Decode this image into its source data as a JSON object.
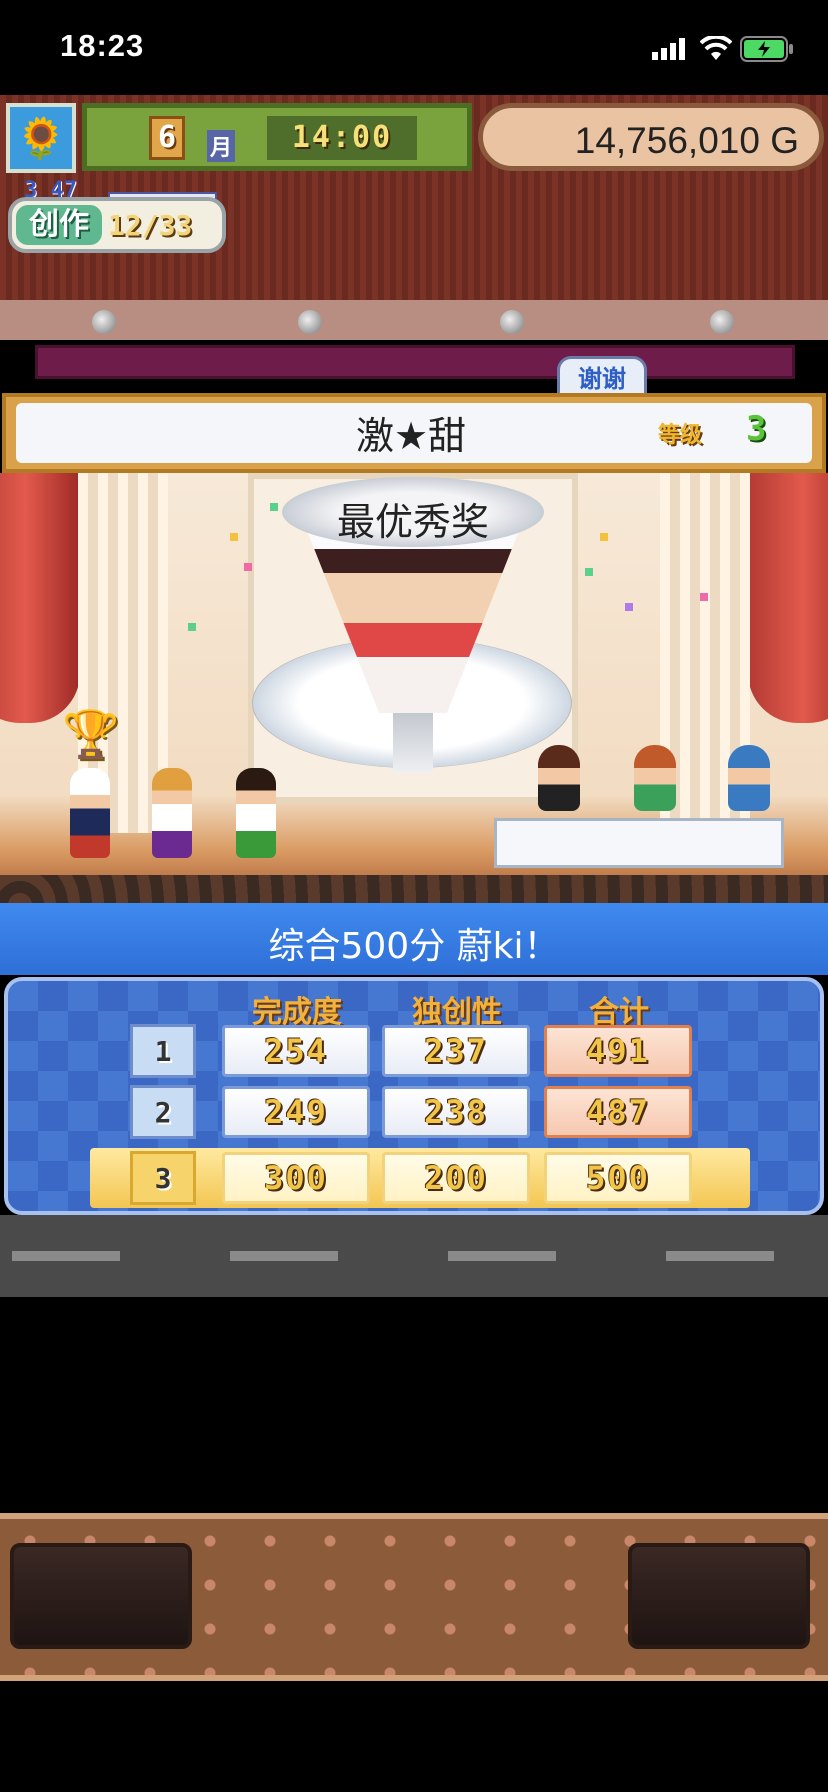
{
  "status_bar": {
    "time": "18:23"
  },
  "hud": {
    "month": "6",
    "month_label": "月",
    "clock": "14:00",
    "money": "14,756,010 G",
    "create_label": "创作",
    "create_count": "12/33",
    "create_sub": "3 47",
    "thanks_tab": "谢谢"
  },
  "dish": {
    "name": "激★甜",
    "grade_label": "等级",
    "grade_value": "3"
  },
  "stage": {
    "award": "最优秀奖"
  },
  "result": {
    "message": "综合500分 蔚ki！"
  },
  "scores": {
    "headers": [
      "完成度",
      "独创性",
      "合计"
    ],
    "rows": [
      {
        "rank": "1",
        "completion": "254",
        "originality": "237",
        "total": "491"
      },
      {
        "rank": "2",
        "completion": "249",
        "originality": "238",
        "total": "487"
      },
      {
        "rank": "3",
        "completion": "300",
        "originality": "200",
        "total": "500"
      }
    ]
  },
  "colors": {
    "accent_blue": "#2f6fd6",
    "gold": "#f2b03c"
  },
  "icons": [
    "sunflower-icon",
    "trophy-icon",
    "signal-icon",
    "wifi-icon",
    "battery-icon"
  ]
}
